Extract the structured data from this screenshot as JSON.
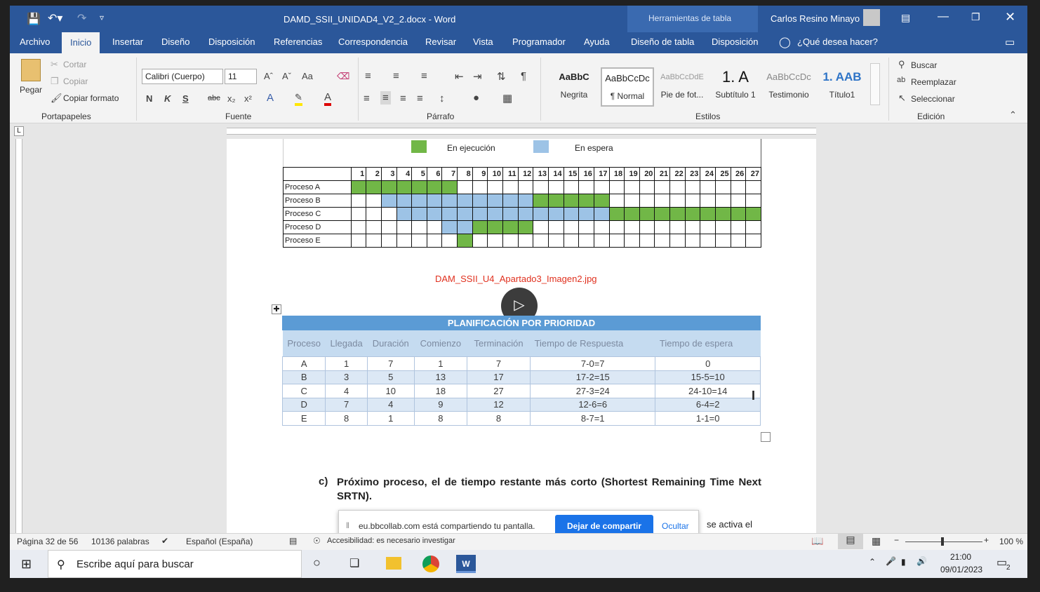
{
  "window": {
    "quick_title": "DAMD_SSII_UNIDAD4_V2_2.docx - Word",
    "context_tab": "Herramientas de tabla",
    "user": "Carlos Resino Minayo"
  },
  "tabs": [
    "Archivo",
    "Inicio",
    "Insertar",
    "Diseño",
    "Disposición",
    "Referencias",
    "Correspondencia",
    "Revisar",
    "Vista",
    "Programador",
    "Ayuda",
    "Diseño de tabla",
    "Disposición"
  ],
  "tell_me": "¿Qué desea hacer?",
  "clipboard": {
    "paste": "Pegar",
    "cut": "Cortar",
    "copy": "Copiar",
    "format_painter": "Copiar formato",
    "group": "Portapapeles"
  },
  "font": {
    "name": "Calibri (Cuerpo)",
    "size": "11",
    "bold": "N",
    "italic": "K",
    "underline": "S",
    "strike": "abc",
    "sub": "x₂",
    "sup": "x²",
    "case": "Aa",
    "grow": "A^",
    "shrink": "A˅",
    "group": "Fuente"
  },
  "paragraph": {
    "group": "Párrafo"
  },
  "styles": {
    "group": "Estilos",
    "items": [
      {
        "preview": "AaBbC",
        "name": "Negrita"
      },
      {
        "preview": "AaBbCcDc",
        "name": "¶ Normal"
      },
      {
        "preview": "AaBbCcDdE",
        "name": "Pie de fot..."
      },
      {
        "preview": "1. A",
        "name": "Subtítulo 1"
      },
      {
        "preview": "AaBbCcDc",
        "name": "Testimonio"
      },
      {
        "preview": "1. AAB",
        "name": "Título1"
      }
    ]
  },
  "editing": {
    "find": "Buscar",
    "replace": "Reemplazar",
    "select": "Seleccionar",
    "group": "Edición"
  },
  "document": {
    "gantt": {
      "legend_exec": "En ejecución",
      "legend_wait": "En espera",
      "columns": [
        "1",
        "2",
        "3",
        "4",
        "5",
        "6",
        "7",
        "8",
        "9",
        "10",
        "11",
        "12",
        "13",
        "14",
        "15",
        "16",
        "17",
        "18",
        "19",
        "20",
        "21",
        "22",
        "23",
        "24",
        "25",
        "26",
        "27"
      ],
      "rows": [
        {
          "name": "Proceso A",
          "cells": "GGGGGGG...................."
        },
        {
          "name": "Proceso B",
          "cells": "..BBBBBBBBBBGGGGG.........."
        },
        {
          "name": "Proceso C",
          "cells": "...BBBBBBBBBBBBBBGGGGGGGGGG"
        },
        {
          "name": "Proceso D",
          "cells": "......BBGGGG..............."
        },
        {
          "name": "Proceso E",
          "cells": ".......G..................."
        }
      ]
    },
    "caption": "DAM_SSII_U4_Apartado3_Imagen2.jpg",
    "priority_table": {
      "title": "PLANIFICACIÓN POR PRIORIDAD",
      "headers": [
        "Proceso",
        "Llegada",
        "Duración",
        "Comienzo",
        "Terminación",
        "Tiempo de Respuesta",
        "Tiempo de espera"
      ],
      "rows": [
        [
          "A",
          "1",
          "7",
          "1",
          "7",
          "7-0=7",
          "0"
        ],
        [
          "B",
          "3",
          "5",
          "13",
          "17",
          "17-2=15",
          "15-5=10"
        ],
        [
          "C",
          "4",
          "10",
          "18",
          "27",
          "27-3=24",
          "24-10=14"
        ],
        [
          "D",
          "7",
          "4",
          "9",
          "12",
          "12-6=6",
          "6-4=2"
        ],
        [
          "E",
          "8",
          "1",
          "8",
          "8",
          "8-7=1",
          "1-1=0"
        ]
      ]
    },
    "heading_c_prefix": "c)",
    "heading_c_text": "Próximo proceso, el de tiempo restante más corto (Shortest Remaining Time Next SRTN).",
    "partial_text": "se activa el"
  },
  "share_bar": {
    "message": "eu.bbcollab.com está compartiendo tu pantalla.",
    "stop": "Dejar de compartir",
    "hide": "Ocultar"
  },
  "statusbar": {
    "page": "Página 32 de 56",
    "words": "10136 palabras",
    "language": "Español (España)",
    "accessibility": "Accesibilidad: es necesario investigar",
    "zoom": "100 %"
  },
  "taskbar": {
    "search": "Escribe aquí para buscar",
    "time": "21:00",
    "date": "09/01/2023",
    "notifications": "2"
  }
}
